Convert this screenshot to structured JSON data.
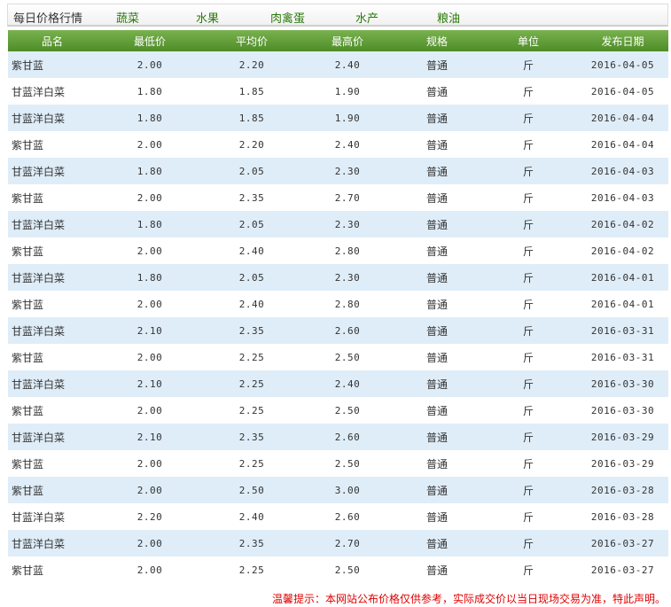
{
  "tabs": [
    "每日价格行情",
    "蔬菜",
    "水果",
    "肉禽蛋",
    "水产",
    "粮油"
  ],
  "table": {
    "headers": [
      "品名",
      "最低价",
      "平均价",
      "最高价",
      "规格",
      "单位",
      "发布日期"
    ],
    "rows": [
      [
        "紫甘蓝",
        "2.00",
        "2.20",
        "2.40",
        "普通",
        "斤",
        "2016-04-05"
      ],
      [
        "甘蓝洋白菜",
        "1.80",
        "1.85",
        "1.90",
        "普通",
        "斤",
        "2016-04-05"
      ],
      [
        "甘蓝洋白菜",
        "1.80",
        "1.85",
        "1.90",
        "普通",
        "斤",
        "2016-04-04"
      ],
      [
        "紫甘蓝",
        "2.00",
        "2.20",
        "2.40",
        "普通",
        "斤",
        "2016-04-04"
      ],
      [
        "甘蓝洋白菜",
        "1.80",
        "2.05",
        "2.30",
        "普通",
        "斤",
        "2016-04-03"
      ],
      [
        "紫甘蓝",
        "2.00",
        "2.35",
        "2.70",
        "普通",
        "斤",
        "2016-04-03"
      ],
      [
        "甘蓝洋白菜",
        "1.80",
        "2.05",
        "2.30",
        "普通",
        "斤",
        "2016-04-02"
      ],
      [
        "紫甘蓝",
        "2.00",
        "2.40",
        "2.80",
        "普通",
        "斤",
        "2016-04-02"
      ],
      [
        "甘蓝洋白菜",
        "1.80",
        "2.05",
        "2.30",
        "普通",
        "斤",
        "2016-04-01"
      ],
      [
        "紫甘蓝",
        "2.00",
        "2.40",
        "2.80",
        "普通",
        "斤",
        "2016-04-01"
      ],
      [
        "甘蓝洋白菜",
        "2.10",
        "2.35",
        "2.60",
        "普通",
        "斤",
        "2016-03-31"
      ],
      [
        "紫甘蓝",
        "2.00",
        "2.25",
        "2.50",
        "普通",
        "斤",
        "2016-03-31"
      ],
      [
        "甘蓝洋白菜",
        "2.10",
        "2.25",
        "2.40",
        "普通",
        "斤",
        "2016-03-30"
      ],
      [
        "紫甘蓝",
        "2.00",
        "2.25",
        "2.50",
        "普通",
        "斤",
        "2016-03-30"
      ],
      [
        "甘蓝洋白菜",
        "2.10",
        "2.35",
        "2.60",
        "普通",
        "斤",
        "2016-03-29"
      ],
      [
        "紫甘蓝",
        "2.00",
        "2.25",
        "2.50",
        "普通",
        "斤",
        "2016-03-29"
      ],
      [
        "紫甘蓝",
        "2.00",
        "2.50",
        "3.00",
        "普通",
        "斤",
        "2016-03-28"
      ],
      [
        "甘蓝洋白菜",
        "2.20",
        "2.40",
        "2.60",
        "普通",
        "斤",
        "2016-03-28"
      ],
      [
        "甘蓝洋白菜",
        "2.00",
        "2.35",
        "2.70",
        "普通",
        "斤",
        "2016-03-27"
      ],
      [
        "紫甘蓝",
        "2.00",
        "2.25",
        "2.50",
        "普通",
        "斤",
        "2016-03-27"
      ]
    ]
  },
  "notice": "温馨提示：本网站公布价格仅供参考，实际成交价以当日现场交易为准，特此声明。",
  "colors": {
    "header_green": "#5a9a32",
    "row_stripe": "#dfedf8",
    "tab_green": "#2b7a0b",
    "notice_red": "#e00000"
  }
}
